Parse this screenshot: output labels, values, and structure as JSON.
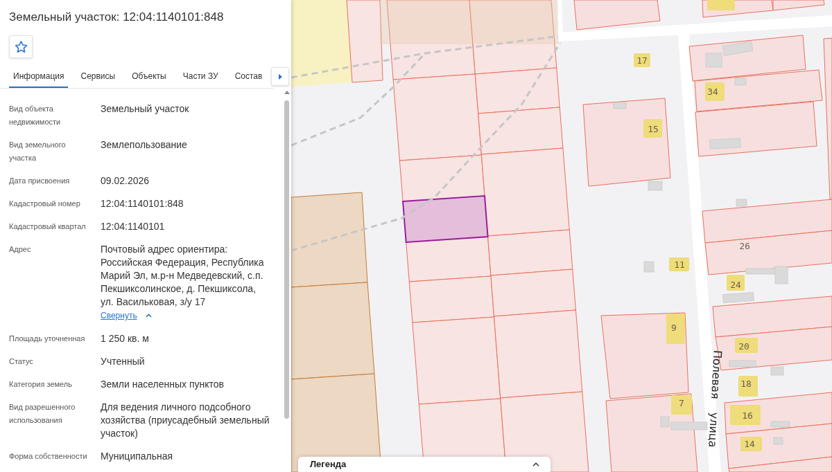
{
  "panel": {
    "title": "Земельный участок: 12:04:1140101:848",
    "favorite": false,
    "tabs": [
      {
        "label": "Информация",
        "selected": true
      },
      {
        "label": "Сервисы",
        "selected": false
      },
      {
        "label": "Объекты",
        "selected": false
      },
      {
        "label": "Части ЗУ",
        "selected": false
      },
      {
        "label": "Состав",
        "selected": false
      }
    ],
    "fields": [
      {
        "label": "Вид объекта недвижимости",
        "value": "Земельный участок"
      },
      {
        "label": "Вид земельного участка",
        "value": "Землепользование"
      },
      {
        "label": "Дата присвоения",
        "value": "09.02.2026"
      },
      {
        "label": "Кадастровый номер",
        "value": "12:04:1140101:848"
      },
      {
        "label": "Кадастровый квартал",
        "value": "12:04:1140101"
      },
      {
        "label": "Адрес",
        "value": "Почтовый адрес ориентира: Российская Федерация, Республика Марий Эл, м.р-н Медведевский, с.п. Пекшиксолинское, д. Пекшиксола, ул. Васильковая, з/у 17",
        "toggle": {
          "label": "Свернуть",
          "expanded": true
        }
      },
      {
        "label": "Площадь уточненная",
        "value": "1 250 кв. м"
      },
      {
        "label": "Статус",
        "value": "Учтенный"
      },
      {
        "label": "Категория земель",
        "value": "Земли населенных пунктов"
      },
      {
        "label": "Вид разрешенного использования",
        "value": "Для ведения личного подсобного хозяйства (приусадебный земельный участок)"
      },
      {
        "label": "Форма собственности",
        "value": "Муниципальная"
      }
    ]
  },
  "map": {
    "house_numbers": [
      "17",
      "34",
      "15",
      "26",
      "11",
      "24",
      "9",
      "20",
      "18",
      "7",
      "16",
      "14"
    ],
    "street_label": "Полевая улица",
    "legend": {
      "title": "Легенда"
    }
  }
}
